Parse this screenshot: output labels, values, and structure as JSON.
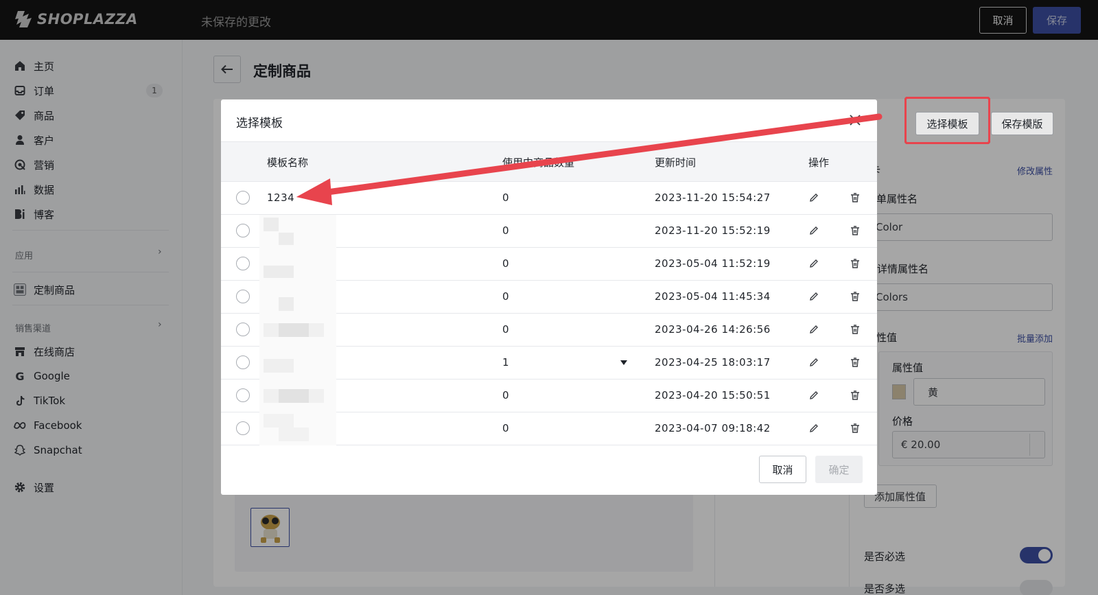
{
  "topbar": {
    "brand": "SHOPLAZZA",
    "status": "未保存的更改",
    "cancel_label": "取消",
    "save_label": "保存"
  },
  "sidebar": {
    "items": [
      {
        "label": "主页",
        "icon": "home-icon"
      },
      {
        "label": "订单",
        "icon": "inbox-icon",
        "badge": "1"
      },
      {
        "label": "商品",
        "icon": "tag-icon"
      },
      {
        "label": "客户",
        "icon": "person-icon"
      },
      {
        "label": "营销",
        "icon": "target-icon"
      },
      {
        "label": "数据",
        "icon": "bar-chart-icon"
      },
      {
        "label": "博客",
        "icon": "blog-icon"
      }
    ],
    "apps_label": "应用",
    "app_items": [
      {
        "label": "定制商品",
        "icon": "app-grid-icon"
      }
    ],
    "channels_label": "销售渠道",
    "channel_items": [
      {
        "label": "在线商店",
        "icon": "store-icon"
      },
      {
        "label": "Google",
        "icon": "google-icon"
      },
      {
        "label": "TikTok",
        "icon": "tiktok-icon"
      },
      {
        "label": "Facebook",
        "icon": "meta-icon"
      },
      {
        "label": "Snapchat",
        "icon": "snapchat-icon"
      }
    ],
    "settings_label": "设置"
  },
  "page": {
    "title": "定制商品",
    "select_template_label": "选择模板",
    "save_template_label": "保存模版",
    "right_panel": {
      "section_suffix": "卡",
      "edit_attr_link": "修改属性",
      "order_attr_label": "订单属性名",
      "order_attr_value": "Color",
      "detail_attr_label": "商品详情属性名",
      "detail_attr_value": "Colors",
      "attr_values_label": "属性值",
      "batch_add_link": "批量添加",
      "attr_value_label": "属性值",
      "attr_value": "黄",
      "price_label": "价格",
      "price_value": "€ 20.00",
      "add_attr_value_label": "添加属性值",
      "required_label": "是否必选",
      "multi_label": "是否多选"
    }
  },
  "modal": {
    "title": "选择模板",
    "columns": [
      "模板名称",
      "使用中商品数量",
      "更新时间",
      "操作"
    ],
    "rows": [
      {
        "name": "1234",
        "count": "0",
        "updated": "2023-11-20 15:54:27"
      },
      {
        "name": "",
        "count": "0",
        "updated": "2023-11-20 15:52:19"
      },
      {
        "name": "",
        "count": "0",
        "updated": "2023-05-04 11:52:19"
      },
      {
        "name": "",
        "count": "0",
        "updated": "2023-05-04 11:45:34"
      },
      {
        "name": "",
        "count": "0",
        "updated": "2023-04-26 14:26:56"
      },
      {
        "name": "",
        "count": "1",
        "updated": "2023-04-25 18:03:17"
      },
      {
        "name": "",
        "count": "0",
        "updated": "2023-04-20 15:50:51"
      },
      {
        "name": "",
        "count": "0",
        "updated": "2023-04-07 09:18:42"
      }
    ],
    "cancel_label": "取消",
    "confirm_label": "确定"
  },
  "colors": {
    "accent": "#3c4fa3",
    "annotation_red": "#e8444d",
    "topbar_bg": "#141414"
  }
}
